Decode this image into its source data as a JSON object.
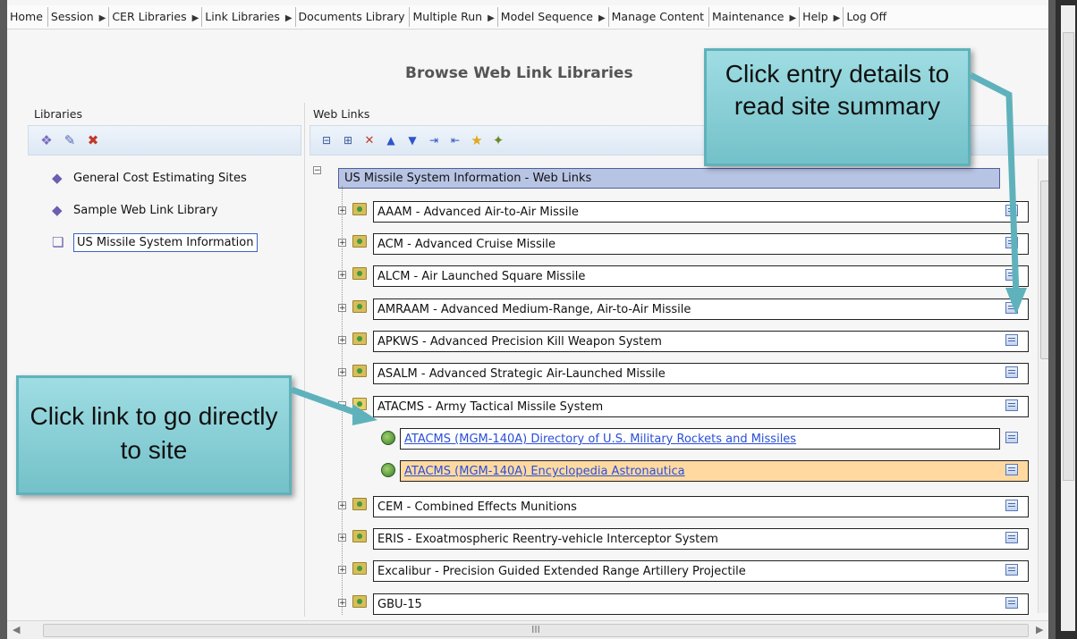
{
  "menu": [
    {
      "label": "Home",
      "arrow": ""
    },
    {
      "label": "Session",
      "arrow": "▶"
    },
    {
      "label": "CER Libraries",
      "arrow": "▶"
    },
    {
      "label": "Link Libraries",
      "arrow": "▶"
    },
    {
      "label": "Documents Library",
      "arrow": ""
    },
    {
      "label": "Multiple Run",
      "arrow": "▶"
    },
    {
      "label": "Model Sequence",
      "arrow": "▶"
    },
    {
      "label": "Manage Content",
      "arrow": ""
    },
    {
      "label": "Maintenance",
      "arrow": "▶"
    },
    {
      "label": "Help",
      "arrow": "▶"
    },
    {
      "label": "Log Off",
      "arrow": ""
    }
  ],
  "page_title": "Browse Web Link Libraries",
  "libraries": {
    "header": "Libraries",
    "items": [
      {
        "label": "General Cost Estimating Sites"
      },
      {
        "label": "Sample Web Link Library"
      },
      {
        "label": "US Missile System Information"
      }
    ]
  },
  "weblinks": {
    "header": "Web Links",
    "root": "US Missile System Information - Web Links",
    "nodes": [
      {
        "label": "AAAM - Advanced Air-to-Air Missile"
      },
      {
        "label": "ACM - Advanced Cruise Missile"
      },
      {
        "label": "ALCM - Air Launched Square Missile"
      },
      {
        "label": "AMRAAM - Advanced Medium-Range, Air-to-Air Missile"
      },
      {
        "label": "APKWS - Advanced Precision Kill Weapon System"
      },
      {
        "label": "ASALM - Advanced Strategic Air-Launched Missile"
      },
      {
        "label": "ATACMS - Army Tactical Missile System"
      },
      {
        "label": "ATACMS (MGM-140A) Directory of U.S. Military Rockets and Missiles"
      },
      {
        "label": "ATACMS (MGM-140A) Encyclopedia Astronautica"
      },
      {
        "label": "CEM - Combined Effects Munitions"
      },
      {
        "label": "ERIS - Exoatmospheric Reentry-vehicle Interceptor System"
      },
      {
        "label": "Excalibur - Precision Guided Extended Range Artillery Projectile"
      },
      {
        "label": "GBU-15"
      }
    ]
  },
  "callouts": {
    "details": "Click entry details to read site summary",
    "link": "Click link to go directly to site"
  },
  "scroll_h_grip": "III"
}
